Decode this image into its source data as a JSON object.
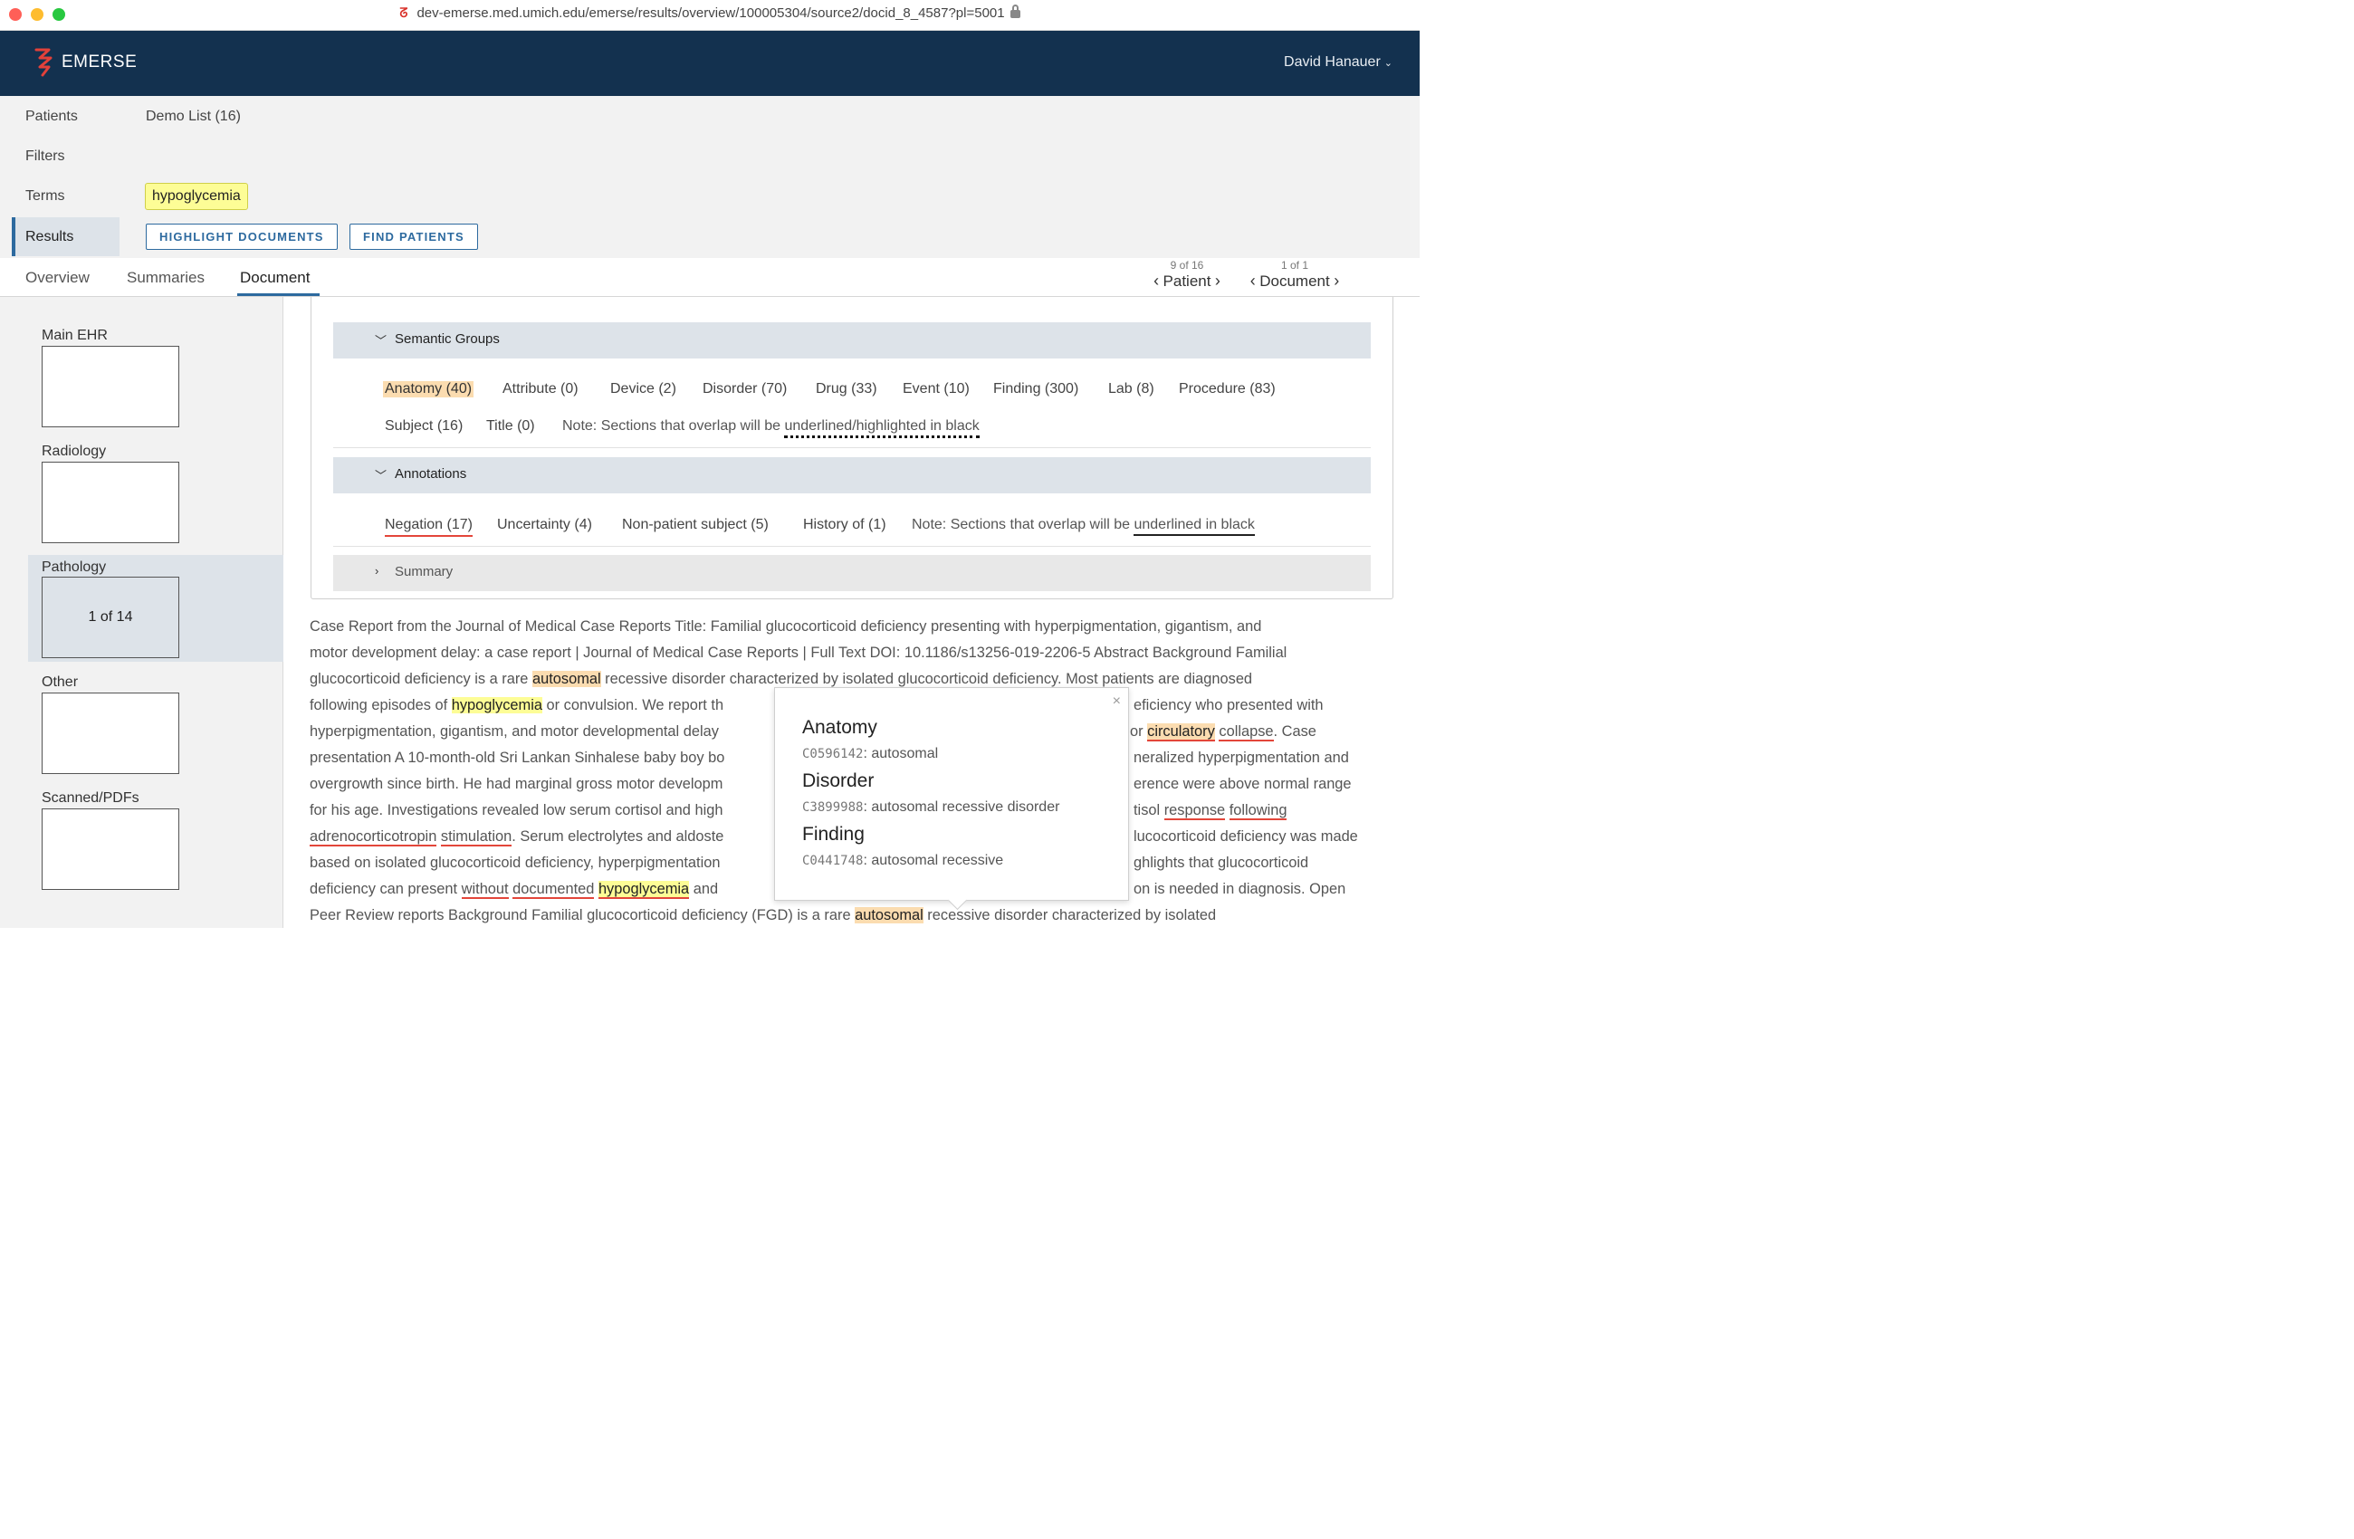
{
  "browser": {
    "url": "dev-emerse.med.umich.edu/emerse/results/overview/100005304/source2/docid_8_4587?pl=5001"
  },
  "header": {
    "app_name": "EMERSE",
    "user_name": "David Hanauer"
  },
  "query": {
    "patients_label": "Patients",
    "patients_value": "Demo List (16)",
    "filters_label": "Filters",
    "terms_label": "Terms",
    "term_chip": "hypoglycemia",
    "results_label": "Results",
    "highlight_button": "HIGHLIGHT DOCUMENTS",
    "find_patients_button": "FIND PATIENTS"
  },
  "tabs": {
    "overview": "Overview",
    "summaries": "Summaries",
    "document": "Document",
    "active": "Document"
  },
  "pager": {
    "patient_count": "9 of 16",
    "patient_label": "Patient",
    "document_count": "1 of 1",
    "document_label": "Document"
  },
  "sources": [
    {
      "label": "Main EHR",
      "count": ""
    },
    {
      "label": "Radiology",
      "count": ""
    },
    {
      "label": "Pathology",
      "count": "1 of 14",
      "active": true
    },
    {
      "label": "Other",
      "count": ""
    },
    {
      "label": "Scanned/PDFs",
      "count": ""
    }
  ],
  "semantic_groups": {
    "title": "Semantic Groups",
    "chips": [
      "Anatomy (40)",
      "Attribute (0)",
      "Device (2)",
      "Disorder (70)",
      "Drug (33)",
      "Event (10)",
      "Finding (300)",
      "Lab (8)",
      "Procedure (83)",
      "Subject (16)",
      "Title (0)"
    ],
    "note_prefix": "Note: Sections that overlap will be ",
    "note_emphasis": "underlined/highlighted in black"
  },
  "annotations": {
    "title": "Annotations",
    "chips": [
      "Negation (17)",
      "Uncertainty (4)",
      "Non-patient subject (5)",
      "History of (1)"
    ],
    "note_prefix": "Note: Sections that overlap will be ",
    "note_emphasis": "underlined in black"
  },
  "summary": {
    "title": "Summary"
  },
  "document_lines": [
    "Case Report from the Journal of Medical Case Reports Title: Familial glucocorticoid deficiency presenting with hyperpigmentation, gigantism, and",
    "motor development delay: a case report | Journal of Medical Case Reports | Full Text DOI: 10.1186/s13256-019-2206-5 Abstract Background Familial",
    [
      "glucocorticoid deficiency is a rare ",
      "autosomal",
      " recessive disorder characterized by isolated glucocorticoid deficiency. Most patients are diagnosed"
    ],
    [
      "following episodes of ",
      "hypoglycemia",
      " or convulsion. We report th",
      "eficiency who presented with"
    ],
    [
      "hyperpigmentation, gigantism, and motor developmental delay",
      " or ",
      "circulatory",
      " ",
      "collapse",
      ". Case"
    ],
    [
      "presentation A 10-month-old Sri Lankan Sinhalese baby boy bo",
      "neralized hyperpigmentation and"
    ],
    [
      "overgrowth since birth. He had marginal gross motor developm",
      "erence were above normal range"
    ],
    [
      "for his age. Investigations revealed low serum cortisol and high",
      "tisol ",
      "response",
      " ",
      "following"
    ],
    [
      "adrenocorticotropin",
      " ",
      "stimulation",
      ". Serum electrolytes and aldoste",
      "lucocorticoid deficiency was made"
    ],
    [
      "based on isolated glucocorticoid deficiency, hyperpigmentation",
      "ghlights that glucocorticoid"
    ],
    [
      "deficiency can present ",
      "without",
      " ",
      "documented",
      " ",
      "hypoglycemia",
      " and",
      "on is needed in diagnosis. Open"
    ],
    [
      "Peer Review reports Background Familial glucocorticoid deficiency (FGD) is a rare ",
      "autosomal",
      " recessive disorder characterized by isolated"
    ]
  ],
  "popup": {
    "groups": [
      {
        "name": "Anatomy",
        "cui": "C0596142",
        "term": "autosomal"
      },
      {
        "name": "Disorder",
        "cui": "C3899988",
        "term": "autosomal recessive disorder"
      },
      {
        "name": "Finding",
        "cui": "C0441748",
        "term": "autosomal recessive"
      }
    ],
    "close_symbol": "×"
  },
  "colors": {
    "header_bg": "#13314f",
    "accent_blue": "#2d6a9f",
    "highlight_yellow": "#fdfd96",
    "highlight_orange": "#fbdcb0",
    "underline_red": "#e3463a",
    "section_header_bg": "#dde3e9"
  }
}
